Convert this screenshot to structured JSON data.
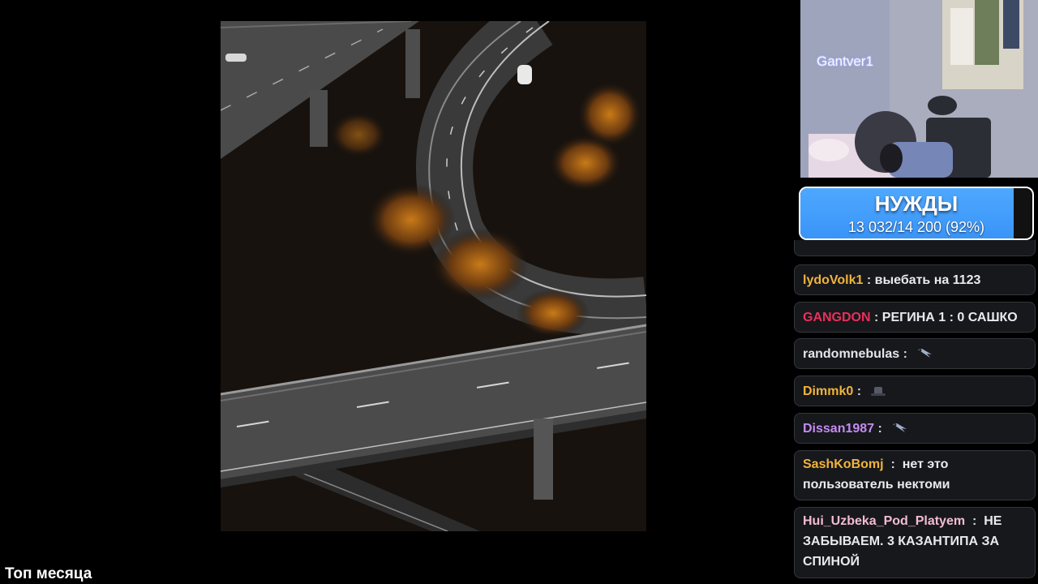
{
  "bottom_label": "Топ месяца",
  "webcam": {
    "name": "Gantver1"
  },
  "needs": {
    "title": "НУЖДЫ",
    "progress_text": "13 032/14 200 (92%)",
    "fraction": 0.92
  },
  "chat": {
    "separator": ":",
    "messages": [
      {
        "user": "lydoVolk1",
        "color": "#f0b43a",
        "text": "выебать на 1123"
      },
      {
        "user": "GANGDON",
        "color": "#e8305a",
        "text": "РЕГИНА 1 : 0 САШКО"
      },
      {
        "user": "randomnebulas",
        "color": "#e4e4ea",
        "text": "",
        "emote": "bird-emote"
      },
      {
        "user": "Dimmk0",
        "color": "#f0b43a",
        "text": "",
        "emote": "hat-emote"
      },
      {
        "user": "Dissan1987",
        "color": "#c48cf2",
        "text": "",
        "emote": "bird-emote"
      },
      {
        "user": "SashKoBomj",
        "color": "#f0b43a",
        "text": "нет это пользователь нектоми"
      },
      {
        "user": "Hui_Uzbeka_Pod_Platyem",
        "color": "#f3bcd0",
        "text": "НЕ ЗАБЫВАЕМ. 3 КАЗАНТИПА ЗА СПИНОЙ"
      }
    ]
  },
  "colors": {
    "needs_fill": "#3a94f8",
    "chat_bg": "#17181c"
  }
}
